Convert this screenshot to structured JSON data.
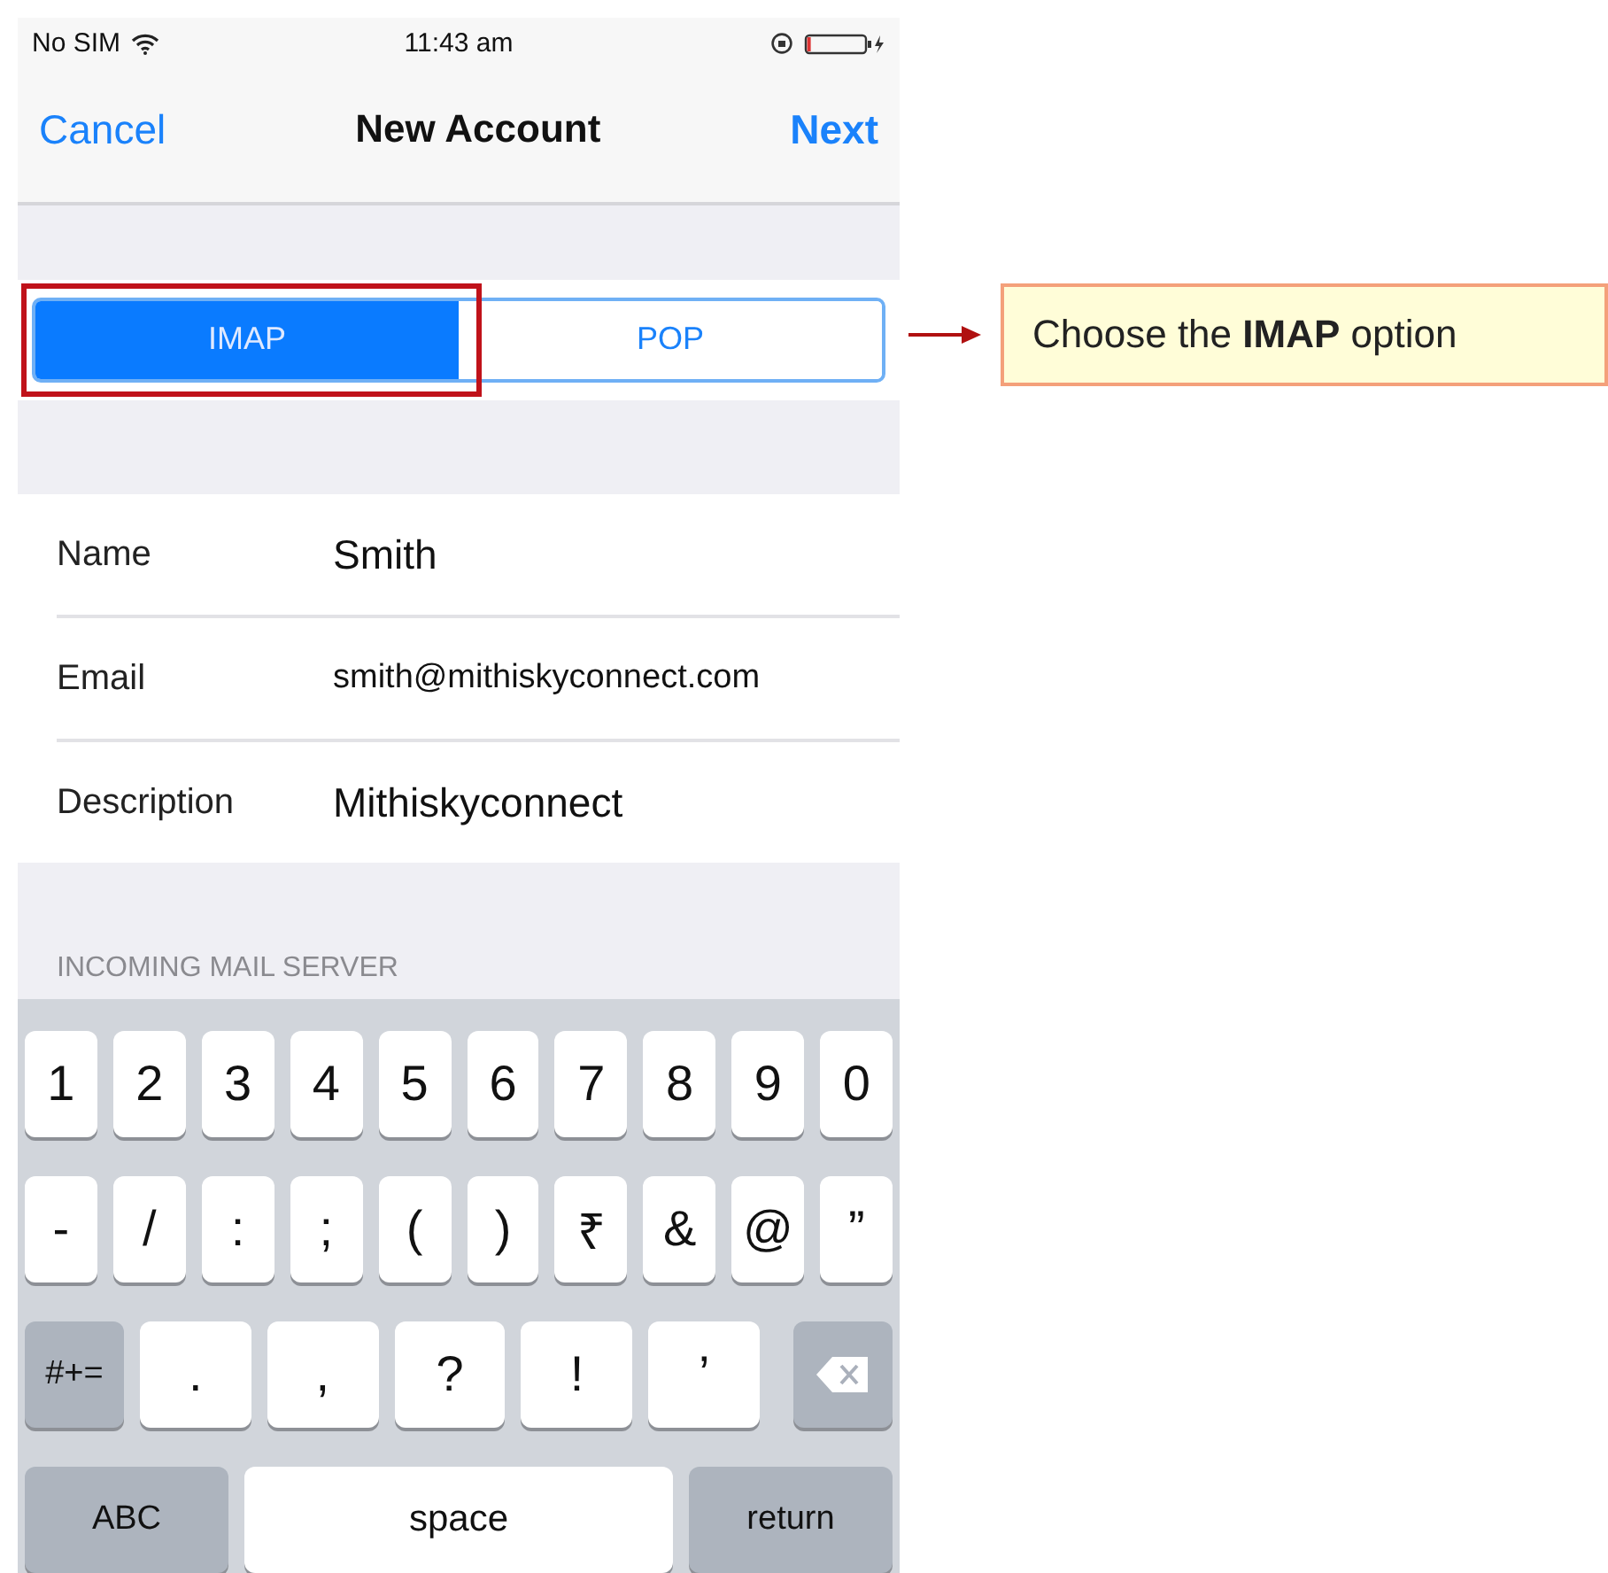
{
  "status_bar": {
    "carrier": "No SIM",
    "time": "11:43 am"
  },
  "nav_bar": {
    "left": "Cancel",
    "title": "New Account",
    "right": "Next"
  },
  "segments": [
    {
      "label": "IMAP",
      "selected": true
    },
    {
      "label": "POP",
      "selected": false
    }
  ],
  "fields": [
    {
      "label": "Name",
      "value": "Smith"
    },
    {
      "label": "Email",
      "value": "smith@mithiskyconnect.com"
    },
    {
      "label": "Description",
      "value": "Mithiskyconnect"
    }
  ],
  "section_header": "INCOMING MAIL SERVER",
  "keyboard": [
    [
      {
        "kind": "char",
        "label": "1"
      },
      {
        "kind": "char",
        "label": "2"
      },
      {
        "kind": "char",
        "label": "3"
      },
      {
        "kind": "char",
        "label": "4"
      },
      {
        "kind": "char",
        "label": "5"
      },
      {
        "kind": "char",
        "label": "6"
      },
      {
        "kind": "char",
        "label": "7"
      },
      {
        "kind": "char",
        "label": "8"
      },
      {
        "kind": "char",
        "label": "9"
      },
      {
        "kind": "char",
        "label": "0"
      }
    ],
    [
      {
        "kind": "char",
        "label": "-"
      },
      {
        "kind": "char",
        "label": "/"
      },
      {
        "kind": "char",
        "label": ":"
      },
      {
        "kind": "char",
        "label": ";"
      },
      {
        "kind": "char",
        "label": "("
      },
      {
        "kind": "char",
        "label": ")"
      },
      {
        "kind": "char",
        "label": "₹"
      },
      {
        "kind": "char",
        "label": "&"
      },
      {
        "kind": "char",
        "label": "@"
      },
      {
        "kind": "char",
        "label": "”"
      }
    ],
    [
      {
        "kind": "function",
        "label": "#+="
      },
      {
        "kind": "wide",
        "label": "."
      },
      {
        "kind": "wide",
        "label": ","
      },
      {
        "kind": "wide",
        "label": "?"
      },
      {
        "kind": "wide",
        "label": "!"
      },
      {
        "kind": "wide",
        "label": "’"
      },
      {
        "kind": "delete"
      }
    ],
    [
      {
        "kind": "function",
        "label": "ABC"
      },
      {
        "kind": "space",
        "label": "space"
      },
      {
        "kind": "function",
        "label": "return"
      }
    ]
  ],
  "callout": {
    "text": "Choose the **IMAP** option"
  }
}
